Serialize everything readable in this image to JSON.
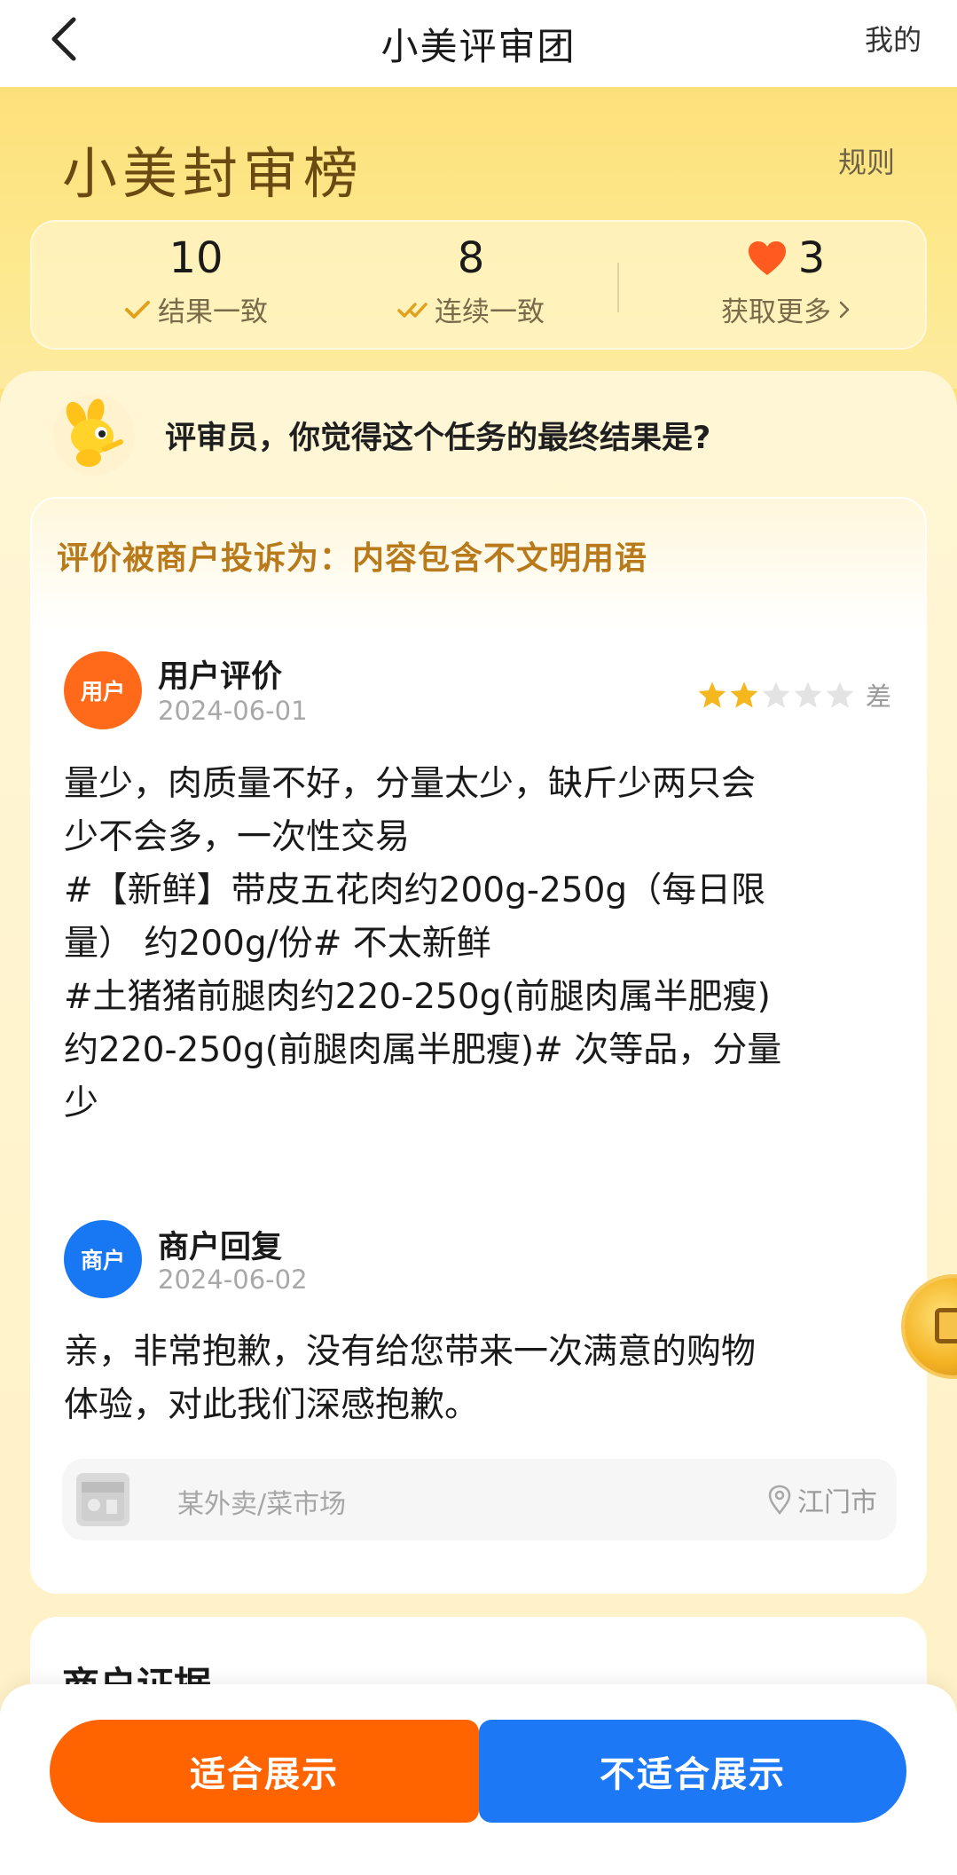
{
  "nav": {
    "title": "小美评审团",
    "right_label": "我的"
  },
  "header": {
    "brand": "小美封审榜",
    "rules": "规则"
  },
  "stats": {
    "consistent_count": "10",
    "consistent_label": "结果一致",
    "streak_count": "8",
    "streak_label": "连续一致",
    "hearts_count": "3",
    "more_label": "获取更多"
  },
  "question": "评审员，你觉得这个任务的最终结果是?",
  "review": {
    "complaint": "评价被商户投诉为：内容包含不文明用语",
    "user": {
      "avatar_label": "用户",
      "title": "用户评价",
      "date": "2024-06-01",
      "rating": 2,
      "rating_max": 5,
      "rating_text": "差",
      "lines": [
        "量少，肉质量不好，分量太少，缺斤少两只会",
        "少不会多，一次性交易",
        "#【新鲜】带皮五花肉约200g-250g（每日限",
        "量） 约200g/份# 不太新鲜",
        "#土猪猪前腿肉约220-250g(前腿肉属半肥瘦)",
        "约220-250g(前腿肉属半肥瘦)# 次等品，分量",
        "少"
      ]
    },
    "merchant": {
      "avatar_label": "商户",
      "title": "商户回复",
      "date": "2024-06-02",
      "lines": [
        "亲，非常抱歉，没有给您带来一次满意的购物",
        "体验，对此我们深感抱歉。"
      ]
    },
    "shop": {
      "name": "某外卖/菜市场",
      "location": "江门市"
    }
  },
  "evidence": {
    "title": "商户证据"
  },
  "actions": {
    "suitable": "适合展示",
    "unsuitable": "不适合展示"
  },
  "colors": {
    "accent_orange": "#ff6400",
    "accent_blue": "#1c78f4",
    "star_gold": "#f5b71e",
    "complaint_text": "#b87a1a"
  }
}
